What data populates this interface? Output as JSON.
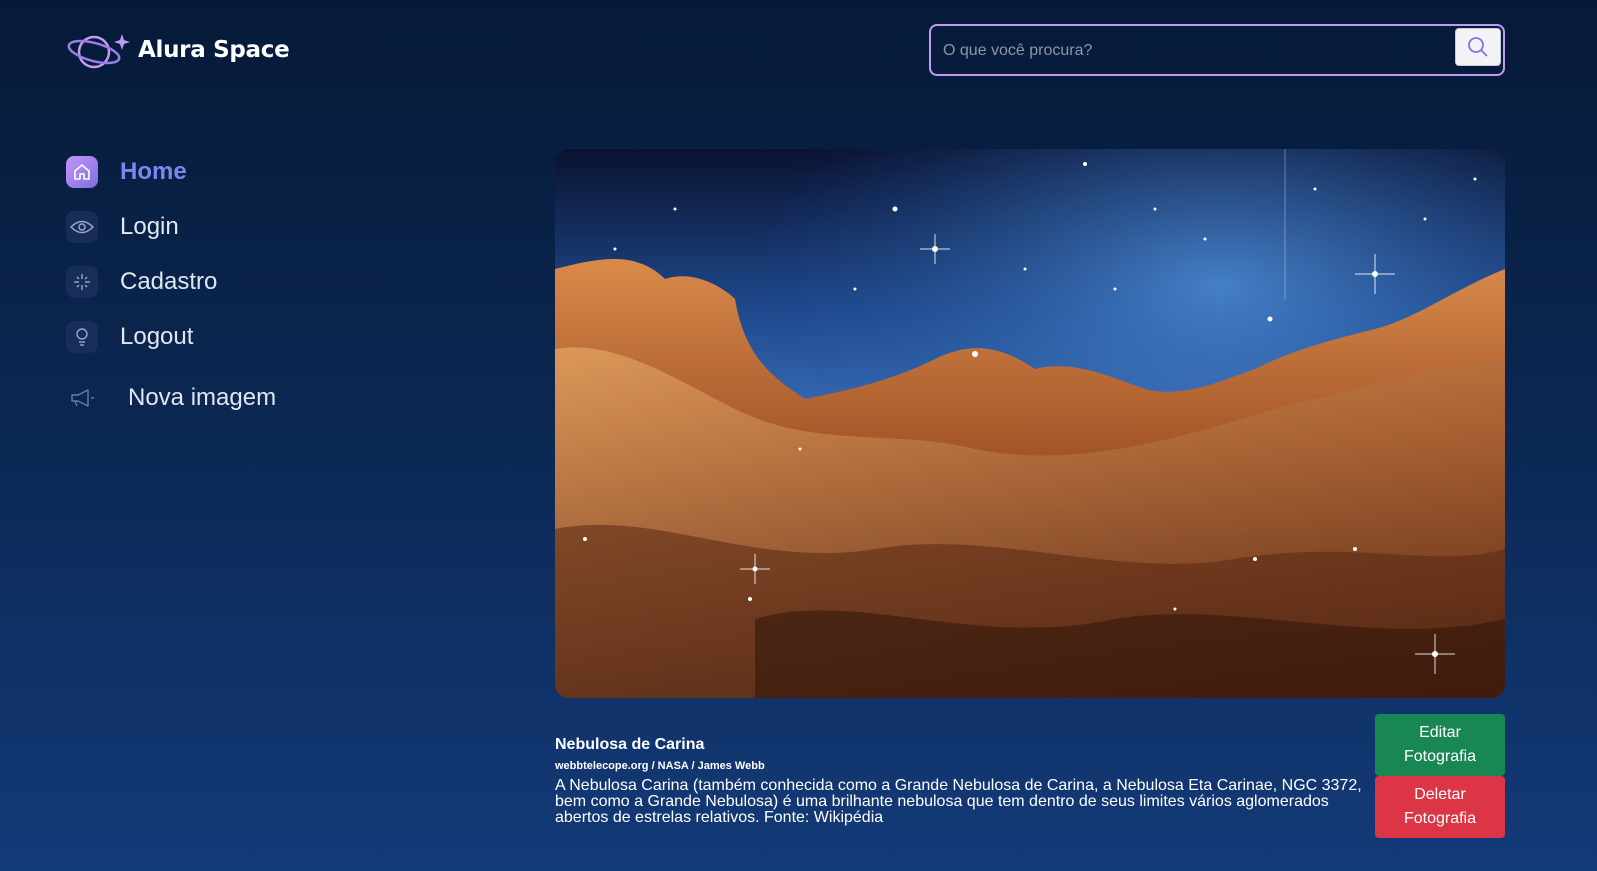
{
  "brand": {
    "name": "Alura Space",
    "accent": "#c29bf0"
  },
  "search": {
    "placeholder": "O que você procura?",
    "icon": "search-icon"
  },
  "nav": {
    "items": [
      {
        "label": "Home",
        "icon": "home-icon",
        "active": true
      },
      {
        "label": "Login",
        "icon": "eye-icon"
      },
      {
        "label": "Cadastro",
        "icon": "sparkle-icon"
      },
      {
        "label": "Logout",
        "icon": "bulb-icon"
      },
      {
        "label": "Nova imagem",
        "icon": "megaphone-icon"
      }
    ]
  },
  "photo": {
    "title": "Nebulosa de Carina",
    "source": "webbtelecope.org / NASA / James Webb",
    "description": "A Nebulosa Carina (também conhecida como a Grande Nebulosa de Carina, a Nebulosa Eta Carinae, NGC 3372, bem como a Grande Nebulosa) é uma brilhante nebulosa que tem dentro de seus limites vários aglomerados abertos de estrelas relativos. Fonte: Wikipédia"
  },
  "actions": {
    "edit_label": "Editar Fotografia",
    "delete_label": "Deletar Fotografia",
    "edit_color": "#198754",
    "delete_color": "#dc3545"
  }
}
